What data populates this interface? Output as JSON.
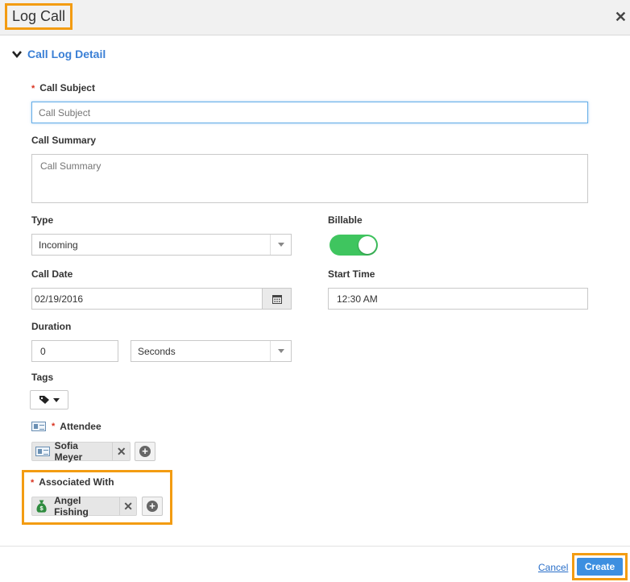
{
  "dialog": {
    "title": "Log Call",
    "close_glyph": "✕"
  },
  "section": {
    "title": "Call Log Detail"
  },
  "fields": {
    "call_subject": {
      "label": "Call Subject",
      "required_mark": "*",
      "placeholder": "Call Subject",
      "value": ""
    },
    "call_summary": {
      "label": "Call Summary",
      "placeholder": "Call Summary",
      "value": ""
    },
    "type": {
      "label": "Type",
      "value": "Incoming"
    },
    "billable": {
      "label": "Billable",
      "on": true
    },
    "call_date": {
      "label": "Call Date",
      "value": "02/19/2016"
    },
    "start_time": {
      "label": "Start Time",
      "value": "12:30 AM"
    },
    "duration": {
      "label": "Duration",
      "value": "0",
      "unit": "Seconds"
    },
    "tags": {
      "label": "Tags"
    },
    "attendee": {
      "label": "Attendee",
      "required_mark": "*",
      "chip": "Sofia Meyer"
    },
    "associated_with": {
      "label": "Associated With",
      "required_mark": "*",
      "chip": "Angel Fishing"
    }
  },
  "footer": {
    "cancel_label": "Cancel",
    "create_label": "Create"
  },
  "colors": {
    "accent": "#3a7fd5",
    "highlight": "#f39c12",
    "toggle_on": "#3fc55f",
    "required": "#d9321f"
  }
}
